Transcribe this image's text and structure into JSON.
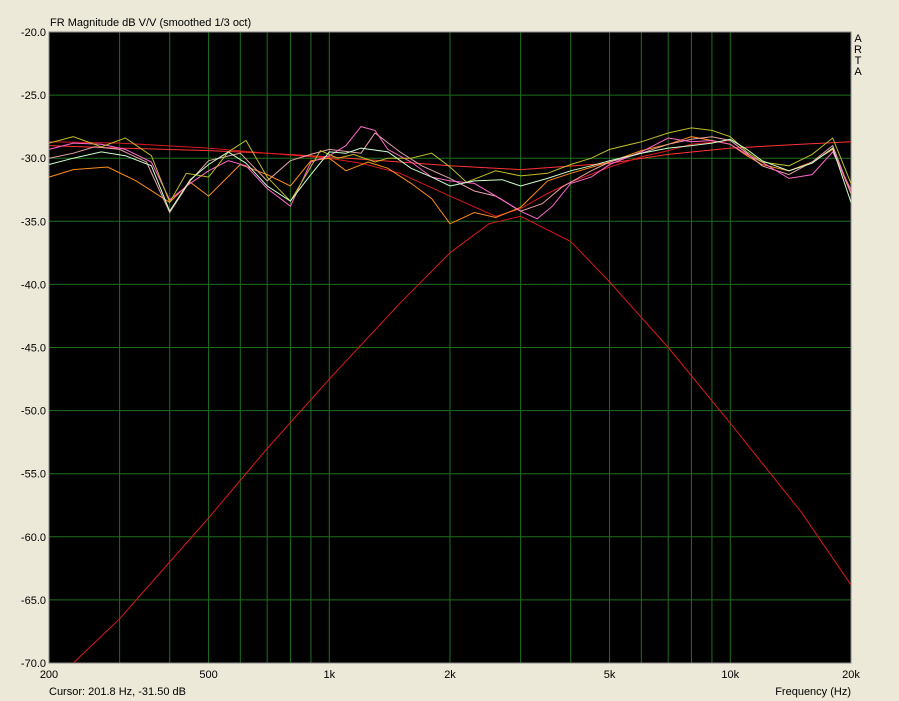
{
  "chart_data": {
    "type": "line",
    "title": "FR Magnitude dB V/V (smoothed 1/3 oct)",
    "xlabel": "Frequency (Hz)",
    "xscale": "log",
    "xlim": [
      200,
      20000
    ],
    "ylim": [
      -70,
      -20
    ],
    "yticks": [
      "-20.0",
      "-25.0",
      "-30.0",
      "-35.0",
      "-40.0",
      "-45.0",
      "-50.0",
      "-55.0",
      "-60.0",
      "-65.0",
      "-70.0"
    ],
    "xticks": [
      {
        "value": 200,
        "label": "200"
      },
      {
        "value": 500,
        "label": "500"
      },
      {
        "value": 1000,
        "label": "1k"
      },
      {
        "value": 2000,
        "label": "2k"
      },
      {
        "value": 5000,
        "label": "5k"
      },
      {
        "value": 10000,
        "label": "10k"
      },
      {
        "value": 20000,
        "label": "20k"
      }
    ],
    "grid": true,
    "background": "#000000",
    "grid_color": "#1e6e1e",
    "series": [
      {
        "color": "#ff3333",
        "x": [
          200,
          300,
          500,
          700,
          1000,
          1500,
          2000,
          3000,
          5000,
          7000,
          10000,
          15000,
          20000
        ],
        "y": [
          -29.0,
          -29.2,
          -29.4,
          -29.6,
          -29.9,
          -30.3,
          -30.6,
          -30.9,
          -30.4,
          -29.7,
          -29.2,
          -28.9,
          -28.7
        ]
      },
      {
        "color": "#d7191c",
        "x": [
          230,
          300,
          400,
          500,
          700,
          1000,
          1500,
          2000,
          2500,
          3000,
          4000,
          5000,
          7000,
          10000,
          15000,
          20000
        ],
        "y": [
          -70,
          -66.5,
          -62.0,
          -58.5,
          -53.0,
          -47.5,
          -41.5,
          -37.5,
          -35.2,
          -34.6,
          -36.6,
          -39.8,
          -45.0,
          -51.0,
          -58.0,
          -63.8
        ]
      },
      {
        "color": "#d7191c",
        "x": [
          200,
          300,
          500,
          700,
          1000,
          1200,
          1500,
          2000,
          2600,
          3000,
          3500,
          4000,
          5000,
          6000,
          7000,
          8000,
          10000
        ],
        "y": [
          -28.7,
          -28.8,
          -29.2,
          -29.6,
          -30.0,
          -30.4,
          -31.2,
          -33.0,
          -34.6,
          -34.0,
          -32.8,
          -31.9,
          -30.7,
          -29.9,
          -29.4,
          -28.9,
          -28.6
        ]
      },
      {
        "color": "#ff8c1a",
        "x": [
          200,
          230,
          280,
          330,
          400,
          450,
          500,
          600,
          700,
          800,
          900,
          1000,
          1100,
          1250,
          1400,
          1600,
          1800,
          2000,
          2300,
          2600,
          3000,
          3500,
          4000,
          5000,
          6000,
          7000,
          8000,
          9000,
          10000,
          11000,
          12000,
          14000,
          16000,
          18000,
          20000
        ],
        "y": [
          -31.5,
          -30.9,
          -30.7,
          -31.8,
          -33.5,
          -31.9,
          -33.0,
          -30.5,
          -31.3,
          -32.2,
          -30.2,
          -30.0,
          -31.0,
          -30.3,
          -30.8,
          -32.0,
          -33.2,
          -35.2,
          -34.3,
          -34.7,
          -33.9,
          -31.8,
          -31.2,
          -30.3,
          -29.4,
          -28.9,
          -28.3,
          -28.6,
          -28.9,
          -29.8,
          -30.5,
          -31.0,
          -30.3,
          -29.3,
          -32.8
        ]
      },
      {
        "color": "#e8a0a8",
        "x": [
          200,
          230,
          260,
          300,
          350,
          400,
          450,
          500,
          600,
          700,
          800,
          900,
          1000,
          1200,
          1300,
          1500,
          1700,
          2000,
          2300,
          2600,
          3000,
          3400,
          3800,
          4500,
          5000,
          6000,
          7000,
          8000,
          9000,
          10000,
          11000,
          12000,
          14000,
          16000,
          18000,
          20000
        ],
        "y": [
          -30.0,
          -29.6,
          -29.1,
          -29.3,
          -30.3,
          -34.3,
          -31.8,
          -30.2,
          -29.6,
          -31.8,
          -30.2,
          -29.7,
          -29.3,
          -29.6,
          -28.0,
          -29.5,
          -30.6,
          -31.6,
          -32.6,
          -33.0,
          -34.2,
          -33.6,
          -32.3,
          -31.0,
          -30.3,
          -29.6,
          -28.9,
          -28.5,
          -28.3,
          -28.6,
          -29.6,
          -30.6,
          -31.3,
          -30.3,
          -29.0,
          -32.8
        ]
      },
      {
        "color": "#ff66cc",
        "x": [
          200,
          230,
          270,
          310,
          360,
          400,
          450,
          500,
          560,
          620,
          700,
          800,
          900,
          1000,
          1100,
          1200,
          1300,
          1400,
          1600,
          1800,
          2000,
          2300,
          2700,
          3000,
          3300,
          3600,
          4000,
          4500,
          5000,
          6000,
          7000,
          8000,
          9000,
          10000,
          11000,
          12000,
          14000,
          16000,
          18000,
          20000
        ],
        "y": [
          -29.3,
          -28.8,
          -28.9,
          -29.3,
          -30.3,
          -33.3,
          -32.0,
          -31.0,
          -30.2,
          -30.6,
          -32.4,
          -33.8,
          -30.3,
          -29.8,
          -29.0,
          -27.5,
          -27.8,
          -29.3,
          -30.3,
          -31.5,
          -31.8,
          -32.0,
          -33.3,
          -34.2,
          -34.8,
          -33.8,
          -32.0,
          -31.5,
          -30.5,
          -29.5,
          -28.4,
          -28.7,
          -28.6,
          -28.9,
          -29.7,
          -30.3,
          -31.6,
          -31.3,
          -29.5,
          -32.5
        ]
      },
      {
        "color": "#bdbd2a",
        "x": [
          200,
          230,
          270,
          310,
          360,
          400,
          440,
          500,
          560,
          620,
          700,
          800,
          850,
          950,
          1050,
          1150,
          1300,
          1400,
          1600,
          1800,
          2000,
          2200,
          2600,
          3000,
          3500,
          4000,
          4500,
          5000,
          6000,
          7000,
          8000,
          9000,
          10000,
          11000,
          12000,
          14000,
          16000,
          18000,
          20000
        ],
        "y": [
          -28.8,
          -28.3,
          -29.1,
          -28.4,
          -29.8,
          -33.5,
          -31.2,
          -31.5,
          -29.5,
          -28.6,
          -31.5,
          -33.4,
          -32.0,
          -29.4,
          -30.0,
          -29.7,
          -30.3,
          -30.0,
          -30.0,
          -29.6,
          -30.7,
          -31.9,
          -31.0,
          -31.4,
          -31.2,
          -30.5,
          -30.0,
          -29.3,
          -28.7,
          -28.0,
          -27.6,
          -27.8,
          -28.3,
          -29.5,
          -30.3,
          -30.6,
          -29.7,
          -28.4,
          -32.0
        ]
      },
      {
        "color": "#ccffcc",
        "x": [
          200,
          230,
          270,
          310,
          360,
          400,
          450,
          500,
          560,
          620,
          700,
          800,
          900,
          1000,
          1100,
          1200,
          1400,
          1600,
          1800,
          2000,
          2300,
          2700,
          3000,
          3500,
          4000,
          4500,
          5000,
          6000,
          7000,
          8000,
          9000,
          10000,
          11000,
          12000,
          14000,
          16000,
          18000,
          20000
        ],
        "y": [
          -30.5,
          -30.0,
          -29.5,
          -29.8,
          -30.6,
          -34.2,
          -31.7,
          -30.5,
          -29.5,
          -30.4,
          -32.2,
          -33.4,
          -31.3,
          -29.5,
          -29.6,
          -29.2,
          -29.5,
          -30.8,
          -31.5,
          -32.2,
          -31.8,
          -31.7,
          -32.2,
          -31.6,
          -31.0,
          -30.6,
          -30.2,
          -29.6,
          -29.2,
          -29.0,
          -28.8,
          -28.5,
          -29.3,
          -30.2,
          -31.0,
          -30.4,
          -29.2,
          -33.5
        ]
      }
    ]
  },
  "side_label": [
    "A",
    "R",
    "T",
    "A"
  ],
  "status": {
    "cursor_text": "Cursor: 201.8 Hz, -31.50 dB"
  }
}
